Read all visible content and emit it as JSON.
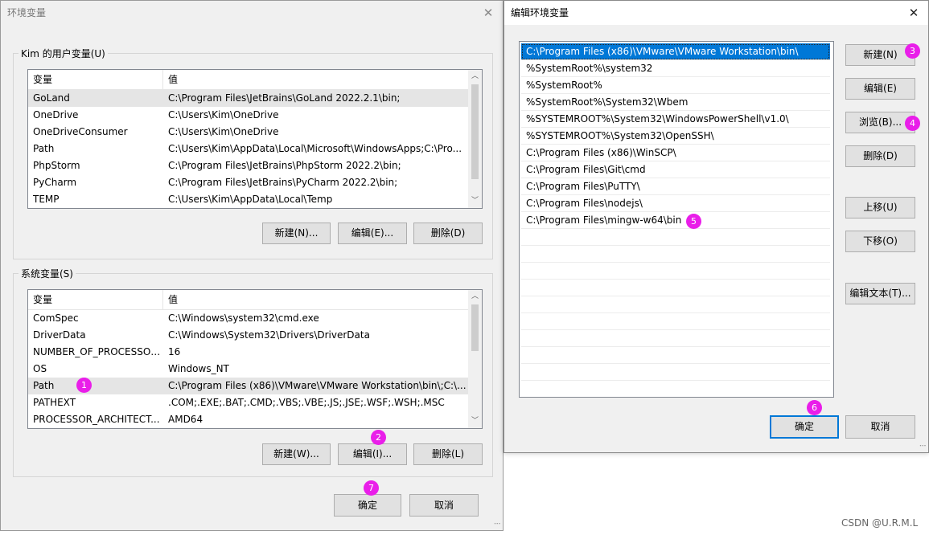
{
  "env_window": {
    "title": "环境变量",
    "user_group_label": "Kim 的用户变量(U)",
    "system_group_label": "系统变量(S)",
    "columns": [
      "变量",
      "值"
    ],
    "user_vars": [
      {
        "name": "GoLand",
        "value": "C:\\Program Files\\JetBrains\\GoLand 2022.2.1\\bin;"
      },
      {
        "name": "OneDrive",
        "value": "C:\\Users\\Kim\\OneDrive"
      },
      {
        "name": "OneDriveConsumer",
        "value": "C:\\Users\\Kim\\OneDrive"
      },
      {
        "name": "Path",
        "value": "C:\\Users\\Kim\\AppData\\Local\\Microsoft\\WindowsApps;C:\\Pro..."
      },
      {
        "name": "PhpStorm",
        "value": "C:\\Program Files\\JetBrains\\PhpStorm 2022.2\\bin;"
      },
      {
        "name": "PyCharm",
        "value": "C:\\Program Files\\JetBrains\\PyCharm 2022.2\\bin;"
      },
      {
        "name": "TEMP",
        "value": "C:\\Users\\Kim\\AppData\\Local\\Temp"
      }
    ],
    "system_vars": [
      {
        "name": "ComSpec",
        "value": "C:\\Windows\\system32\\cmd.exe"
      },
      {
        "name": "DriverData",
        "value": "C:\\Windows\\System32\\Drivers\\DriverData"
      },
      {
        "name": "NUMBER_OF_PROCESSORS",
        "value": "16"
      },
      {
        "name": "OS",
        "value": "Windows_NT"
      },
      {
        "name": "Path",
        "value": "C:\\Program Files (x86)\\VMware\\VMware Workstation\\bin\\;C:\\..."
      },
      {
        "name": "PATHEXT",
        "value": ".COM;.EXE;.BAT;.CMD;.VBS;.VBE;.JS;.JSE;.WSF;.WSH;.MSC"
      },
      {
        "name": "PROCESSOR_ARCHITECT...",
        "value": "AMD64"
      }
    ],
    "user_buttons": {
      "new": "新建(N)...",
      "edit": "编辑(E)...",
      "delete": "删除(D)"
    },
    "system_buttons": {
      "new": "新建(W)...",
      "edit": "编辑(I)...",
      "delete": "删除(L)"
    },
    "ok": "确定",
    "cancel": "取消"
  },
  "edit_window": {
    "title": "编辑环境变量",
    "paths": [
      "C:\\Program Files (x86)\\VMware\\VMware Workstation\\bin\\",
      "%SystemRoot%\\system32",
      "%SystemRoot%",
      "%SystemRoot%\\System32\\Wbem",
      "%SYSTEMROOT%\\System32\\WindowsPowerShell\\v1.0\\",
      "%SYSTEMROOT%\\System32\\OpenSSH\\",
      "C:\\Program Files (x86)\\WinSCP\\",
      "C:\\Program Files\\Git\\cmd",
      "C:\\Program Files\\PuTTY\\",
      "C:\\Program Files\\nodejs\\",
      "C:\\Program Files\\mingw-w64\\bin"
    ],
    "buttons": {
      "new": "新建(N)",
      "edit": "编辑(E)",
      "browse": "浏览(B)...",
      "delete": "删除(D)",
      "move_up": "上移(U)",
      "move_down": "下移(O)",
      "edit_text": "编辑文本(T)..."
    },
    "ok": "确定",
    "cancel": "取消"
  },
  "badges": [
    "1",
    "2",
    "3",
    "4",
    "5",
    "6",
    "7"
  ],
  "watermark": "CSDN @U.R.M.L",
  "colors": {
    "badge": "#e91ee9",
    "selection": "#0078d7"
  }
}
